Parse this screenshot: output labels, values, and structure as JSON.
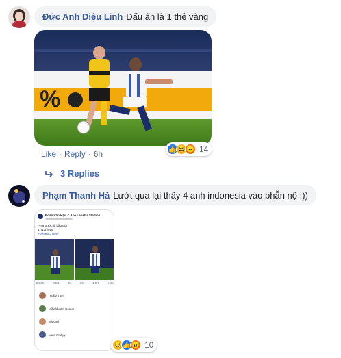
{
  "comment1": {
    "author": "Đức Anh Diệu Linh",
    "text": "Dấu ấn là 1 thẻ vàng",
    "actions": {
      "like": "Like",
      "reply": "Reply",
      "time": "6h"
    },
    "reaction_count": "14",
    "reactions": [
      "like-icon",
      "haha-icon",
      "angry-icon"
    ],
    "replies_label": "3 Replies",
    "photo": {
      "sponsor_text": "%"
    }
  },
  "comment2": {
    "author": "Phạm Thanh Hà",
    "text": "Lướt qua lại thấy 4 anh indonesia vào phẫn nộ :))",
    "reaction_count": "10",
    "reactions": [
      "haha-icon",
      "like-icon",
      "angry-icon"
    ],
    "screenshot": {
      "page_name": "Đoàn Văn Hậu ✓ Abe Lenstra Stadion",
      "post_text": "Phía trước là bầu trời",
      "hashtag": "#DreamChaser",
      "date": "17/12/2019",
      "stats": [
        "24.3K",
        "9.8K",
        "3K",
        "2K",
        "1.9K",
        "1.8K"
      ],
      "reactors": [
        "Haffiiz Hzm",
        "Miftakhudin Bonjer",
        "Sika Cil",
        "Luan Riskyy"
      ]
    }
  },
  "colors": {
    "link": "#385898",
    "action": "#4267b2",
    "bubble": "#f2f3f5",
    "like": "#1877f2",
    "haha": "#f7b125",
    "angry": "#e9710f"
  }
}
